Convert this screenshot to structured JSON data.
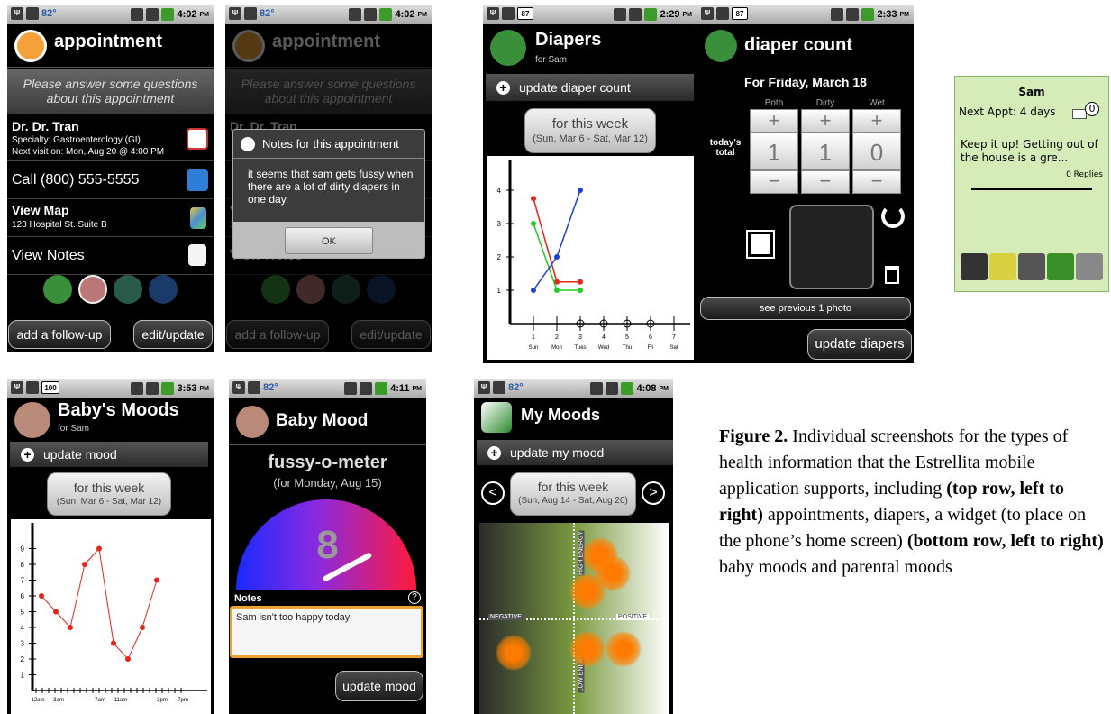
{
  "status": {
    "temp": "82°",
    "t1": "4:02",
    "t2": "4:02",
    "t3": "2:29",
    "t4": "2:33",
    "t5": "3:53",
    "t6": "4:11",
    "t7": "4:08",
    "pm": "PM",
    "b87": "87",
    "b100": "100"
  },
  "appointment": {
    "title": "appointment",
    "prompt": "Please answer some questions about this appointment",
    "doctor": "Dr. Dr. Tran",
    "specialty": "Specialty: Gastroenterology (GI)",
    "next_visit": "Next visit on: Mon, Aug 20 @ 4:00 PM",
    "call": "Call (800) 555-5555",
    "view_map": "View Map",
    "address": "123 Hospital St. Suite B",
    "view_notes": "View Notes",
    "followup_btn": "add a follow-up",
    "edit_btn": "edit/update"
  },
  "notes_dialog": {
    "title": "Notes for this appointment",
    "body": "it seems that sam gets fussy when there are a lot of dirty diapers in one day.",
    "ok": "OK"
  },
  "diapers": {
    "title": "Diapers",
    "subtitle": "for Sam",
    "update": "update diaper count",
    "week_label": "for this week",
    "week_range": "(Sun, Mar 6 - Sat, Mar 12)"
  },
  "diaper_count": {
    "title": "diaper count",
    "date": "For Friday, March 18",
    "columns": [
      "Both",
      "Dirty",
      "Wet"
    ],
    "row_label_line1": "today's",
    "row_label_line2": "total",
    "values": [
      "1",
      "1",
      "0"
    ],
    "see_previous": "see previous 1 photo",
    "update_btn": "update diapers"
  },
  "widget": {
    "name": "Sam",
    "next_appt": "Next Appt: 4 days",
    "badge": "0",
    "message": "Keep it up! Getting out of the house is a gre...",
    "replies": "0 Replies"
  },
  "baby_moods": {
    "title": "Baby's Moods",
    "subtitle": "for Sam",
    "update": "update mood",
    "week_label": "for this week",
    "week_range": "(Sun, Mar 6 - Sat, Mar 12)"
  },
  "baby_mood": {
    "title": "Baby Mood",
    "meter_title": "fussy-o-meter",
    "meter_date": "(for Monday, Aug 15)",
    "value": "8",
    "notes_label": "Notes",
    "help": "?",
    "notes_text": "Sam isn't too happy today",
    "update_btn": "update mood"
  },
  "my_moods": {
    "title": "My Moods",
    "update": "update my mood",
    "week_label": "for this week",
    "week_range": "(Sun, Aug 14 - Sat, Aug 20)",
    "high": "HIGH ENERGY",
    "low": "LOW ENERGY",
    "negative": "NEGATIVE",
    "positive": "POSITIVE"
  },
  "caption": {
    "label": "Figure 2.",
    "t1": " Individual screenshots for the types of health information that the Estrellita mobile application supports, including ",
    "b1": "(top row, left to right)",
    "t2": " appointments, diapers, a widget (to place on the phone’s home screen) ",
    "b2": "(bottom row, left to right)",
    "t3": " baby moods and parental moods"
  },
  "chart_data": [
    {
      "type": "line",
      "x": [
        "1",
        "2",
        "3",
        "4",
        "5",
        "6",
        "7"
      ],
      "x_day_labels": [
        "Sun",
        "Mon",
        "Tues",
        "Wed",
        "Thu",
        "Fri",
        "Sat"
      ],
      "ylim": [
        0,
        4
      ],
      "y_ticks": [
        "1",
        "2",
        "3",
        "4"
      ],
      "series": [
        {
          "values": [
            3.75,
            1.25,
            1.25
          ],
          "color": "#e8231c"
        },
        {
          "values": [
            3,
            1,
            1
          ],
          "color": "#22cc22"
        },
        {
          "values": [
            1,
            2,
            4
          ],
          "color": "#1f3fcf"
        }
      ]
    },
    {
      "type": "line",
      "categories": [
        "12am",
        "3am",
        "",
        "7am",
        "11am",
        "",
        "3pm",
        "7pm"
      ],
      "ylim": [
        0,
        9.5
      ],
      "y_ticks": [
        "1",
        "2",
        "3",
        "4",
        "5",
        "6",
        "7",
        "8",
        "9"
      ],
      "series": [
        {
          "x": [
            1,
            2,
            3,
            4,
            5,
            6,
            7,
            8,
            9
          ],
          "values": [
            6,
            5,
            4,
            8,
            9,
            3,
            2,
            4,
            7
          ],
          "color": "#e8231c"
        }
      ]
    }
  ]
}
